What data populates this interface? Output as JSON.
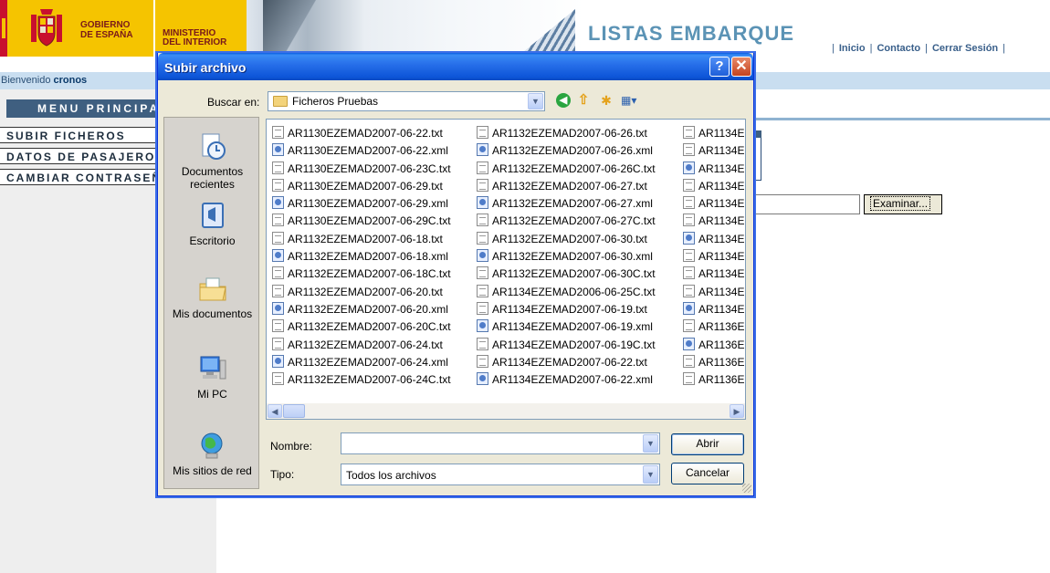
{
  "header": {
    "gov_line1": "GOBIERNO",
    "gov_line2": "DE ESPAÑA",
    "ministry_line1": "MINISTERIO",
    "ministry_line2": "DEL INTERIOR",
    "site_title": "LISTAS EMBARQUE",
    "links": [
      "Inicio",
      "Contacto",
      "Cerrar Sesión"
    ]
  },
  "welcome": {
    "prefix": "Bienvenido",
    "user": "cronos"
  },
  "sidebar": {
    "menu_title": "MENU PRINCIPAL",
    "items": [
      "SUBIR FICHEROS",
      "DATOS DE PASAJEROS",
      "CAMBIAR CONTRASEÑA"
    ]
  },
  "background_form": {
    "browse_label": "Examinar..."
  },
  "dialog": {
    "title": "Subir archivo",
    "help_glyph": "?",
    "close_glyph": "✕",
    "lookin_label": "Buscar en:",
    "lookin_value": "Ficheros Pruebas",
    "places": [
      "Documentos recientes",
      "Escritorio",
      "Mis documentos",
      "Mi PC",
      "Mis sitios de red"
    ],
    "columns": [
      [
        {
          "name": "AR1130EZEMAD2007-06-22.txt",
          "type": "txt"
        },
        {
          "name": "AR1130EZEMAD2007-06-22.xml",
          "type": "xml"
        },
        {
          "name": "AR1130EZEMAD2007-06-23C.txt",
          "type": "txt"
        },
        {
          "name": "AR1130EZEMAD2007-06-29.txt",
          "type": "txt"
        },
        {
          "name": "AR1130EZEMAD2007-06-29.xml",
          "type": "xml"
        },
        {
          "name": "AR1130EZEMAD2007-06-29C.txt",
          "type": "txt"
        },
        {
          "name": "AR1132EZEMAD2007-06-18.txt",
          "type": "txt"
        },
        {
          "name": "AR1132EZEMAD2007-06-18.xml",
          "type": "xml"
        },
        {
          "name": "AR1132EZEMAD2007-06-18C.txt",
          "type": "txt"
        },
        {
          "name": "AR1132EZEMAD2007-06-20.txt",
          "type": "txt"
        },
        {
          "name": "AR1132EZEMAD2007-06-20.xml",
          "type": "xml"
        },
        {
          "name": "AR1132EZEMAD2007-06-20C.txt",
          "type": "txt"
        },
        {
          "name": "AR1132EZEMAD2007-06-24.txt",
          "type": "txt"
        },
        {
          "name": "AR1132EZEMAD2007-06-24.xml",
          "type": "xml"
        },
        {
          "name": "AR1132EZEMAD2007-06-24C.txt",
          "type": "txt"
        }
      ],
      [
        {
          "name": "AR1132EZEMAD2007-06-26.txt",
          "type": "txt"
        },
        {
          "name": "AR1132EZEMAD2007-06-26.xml",
          "type": "xml"
        },
        {
          "name": "AR1132EZEMAD2007-06-26C.txt",
          "type": "txt"
        },
        {
          "name": "AR1132EZEMAD2007-06-27.txt",
          "type": "txt"
        },
        {
          "name": "AR1132EZEMAD2007-06-27.xml",
          "type": "xml"
        },
        {
          "name": "AR1132EZEMAD2007-06-27C.txt",
          "type": "txt"
        },
        {
          "name": "AR1132EZEMAD2007-06-30.txt",
          "type": "txt"
        },
        {
          "name": "AR1132EZEMAD2007-06-30.xml",
          "type": "xml"
        },
        {
          "name": "AR1132EZEMAD2007-06-30C.txt",
          "type": "txt"
        },
        {
          "name": "AR1134EZEMAD2006-06-25C.txt",
          "type": "txt"
        },
        {
          "name": "AR1134EZEMAD2007-06-19.txt",
          "type": "txt"
        },
        {
          "name": "AR1134EZEMAD2007-06-19.xml",
          "type": "xml"
        },
        {
          "name": "AR1134EZEMAD2007-06-19C.txt",
          "type": "txt"
        },
        {
          "name": "AR1134EZEMAD2007-06-22.txt",
          "type": "txt"
        },
        {
          "name": "AR1134EZEMAD2007-06-22.xml",
          "type": "xml"
        }
      ],
      [
        {
          "name": "AR1134E",
          "type": "txt"
        },
        {
          "name": "AR1134E",
          "type": "txt"
        },
        {
          "name": "AR1134E",
          "type": "xml"
        },
        {
          "name": "AR1134E",
          "type": "txt"
        },
        {
          "name": "AR1134E",
          "type": "txt"
        },
        {
          "name": "AR1134E",
          "type": "txt"
        },
        {
          "name": "AR1134E",
          "type": "xml"
        },
        {
          "name": "AR1134E",
          "type": "txt"
        },
        {
          "name": "AR1134E",
          "type": "txt"
        },
        {
          "name": "AR1134E",
          "type": "txt"
        },
        {
          "name": "AR1134E",
          "type": "xml"
        },
        {
          "name": "AR1136E",
          "type": "txt"
        },
        {
          "name": "AR1136E",
          "type": "xml"
        },
        {
          "name": "AR1136E",
          "type": "txt"
        },
        {
          "name": "AR1136E",
          "type": "txt"
        }
      ]
    ],
    "name_label": "Nombre:",
    "name_value": "",
    "type_label": "Tipo:",
    "type_value": "Todos los archivos",
    "open_label": "Abrir",
    "cancel_label": "Cancelar"
  },
  "colors": {
    "titlebar": "#2870ea",
    "menu_header": "#3f5f80",
    "welcome_bar": "#c9def0",
    "site_title": "#5b93b5",
    "logo_yellow": "#f5c400"
  }
}
